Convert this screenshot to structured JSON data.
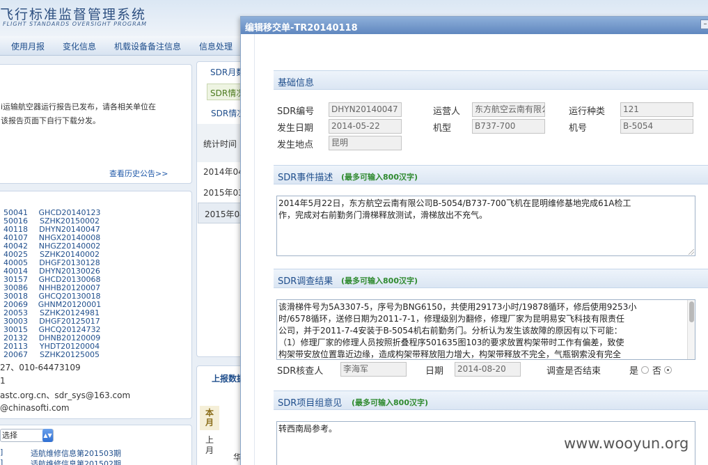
{
  "app": {
    "title": "飞行标准监督管理系统",
    "subtitle": "FLIGHT STANDARDS OVERSIGHT PROGRAM",
    "nav": [
      "使用月报",
      "变化信息",
      "机载设备备注信息",
      "信息处理"
    ]
  },
  "notice": {
    "lines": [
      "i运输航空器运行报告已发布，请各相关单位在",
      "该报告页面下自行下载分发。"
    ],
    "history_link": "查看历史公告>>"
  },
  "sdr_list": [
    {
      "a": "50041",
      "b": "GHCD20140123"
    },
    {
      "a": "50016",
      "b": "SZHK20150002"
    },
    {
      "a": "40118",
      "b": "DHYN20140047"
    },
    {
      "a": "40107",
      "b": "NHGX20140008"
    },
    {
      "a": "40042",
      "b": "NHGZ20140002"
    },
    {
      "a": "40025",
      "b": "SZHK20140002"
    },
    {
      "a": "40005",
      "b": "DHGF20130128"
    },
    {
      "a": "40014",
      "b": "DHYN20130026"
    },
    {
      "a": "30157",
      "b": "GHCD20130068"
    },
    {
      "a": "30086",
      "b": "NHHB20120007"
    },
    {
      "a": "30018",
      "b": "GHCQ20130018"
    },
    {
      "a": "20069",
      "b": "GHNM20120001"
    },
    {
      "a": "20053",
      "b": "SZHK20124981"
    },
    {
      "a": "30003",
      "b": "DHGF20125017"
    },
    {
      "a": "30015",
      "b": "GHCQ20124732"
    },
    {
      "a": "20132",
      "b": "DHNB20120009"
    },
    {
      "a": "20113",
      "b": "YHDT20120004"
    },
    {
      "a": "20067",
      "b": "SZHK20125005"
    }
  ],
  "contact": {
    "phone": "27、010-64473109",
    "line2": "1",
    "email": "astc.org.cn、sdr_sys@163.com",
    "email2": "@chinasofti.com"
  },
  "select": {
    "value": "选择"
  },
  "info_links": [
    {
      "prefix": "]",
      "text": "适航维修信息第201503期"
    },
    {
      "prefix": "]",
      "text": "适航维修信息第201502期"
    }
  ],
  "mid_panel": {
    "tabs": [
      "SDR月数",
      "SDR情况",
      "SDR情况"
    ],
    "col_header": "统计时间",
    "rows": [
      "2014年04",
      "2015年03",
      "2015年04"
    ],
    "upload_tab": "上报数据",
    "month_tab": "本月",
    "prev_month": "上月",
    "cell_partial": "华"
  },
  "modal": {
    "title": "编辑移交单-TR20140118",
    "close_glyph": "–",
    "basic": {
      "section_title": "基础信息",
      "sdr_no_label": "SDR编号",
      "sdr_no": "DHYN20140047",
      "operator_label": "运营人",
      "operator": "东方航空云南有限公司",
      "op_type_label": "运行种类",
      "op_type": "121",
      "date_label": "发生日期",
      "date": "2014-05-22",
      "model_label": "机型",
      "model": "B737-700",
      "reg_label": "机号",
      "reg": "B-5054",
      "place_label": "发生地点",
      "place": "昆明"
    },
    "event": {
      "section_title": "SDR事件描述",
      "hint": "(最多可输入800汉字)",
      "lines": [
        "2014年5月22日，东方航空云南有限公司B-5054/B737-700飞机在昆明维修基地完成61A检工",
        "作，完成对右前勤务门滑梯释放测试，滑梯放出不充气。"
      ]
    },
    "investigation": {
      "section_title": "SDR调查结果",
      "hint": "(最多可输入800汉字)",
      "lines": [
        "该滑梯件号为5A3307-5，序号为BNG6150，共使用29173小时/19878循环，修后使用9253小",
        "时/6578循环，送修日期为2011-7-1，修理级别为翻修，修理厂家为昆明易安飞科技有限责任",
        "公司，并于2011-7-4安装于B-5054机右前勤务门。分析认为发生该故障的原因有以下可能：",
        "（1）修理厂家的修理人员按照折叠程序501635图103的要求放置构架带时工作有偏差，致使",
        "构架带安放位置靠近边缘，造成构架带释放阻力增大，构架带释放不完全，气瓶钢索没有完全"
      ],
      "reviewer_label": "SDR核查人",
      "reviewer": "李海军",
      "date_label": "日期",
      "date": "2014-08-20",
      "closed_label": "调查是否结束",
      "yes_label": "是",
      "no_label": "否",
      "closed_value": "否"
    },
    "opinion": {
      "section_title": "SDR项目组意见",
      "hint": "(最多可输入800汉字)",
      "text": "转西南局参考。"
    }
  },
  "watermark": "www.wooyun.org"
}
